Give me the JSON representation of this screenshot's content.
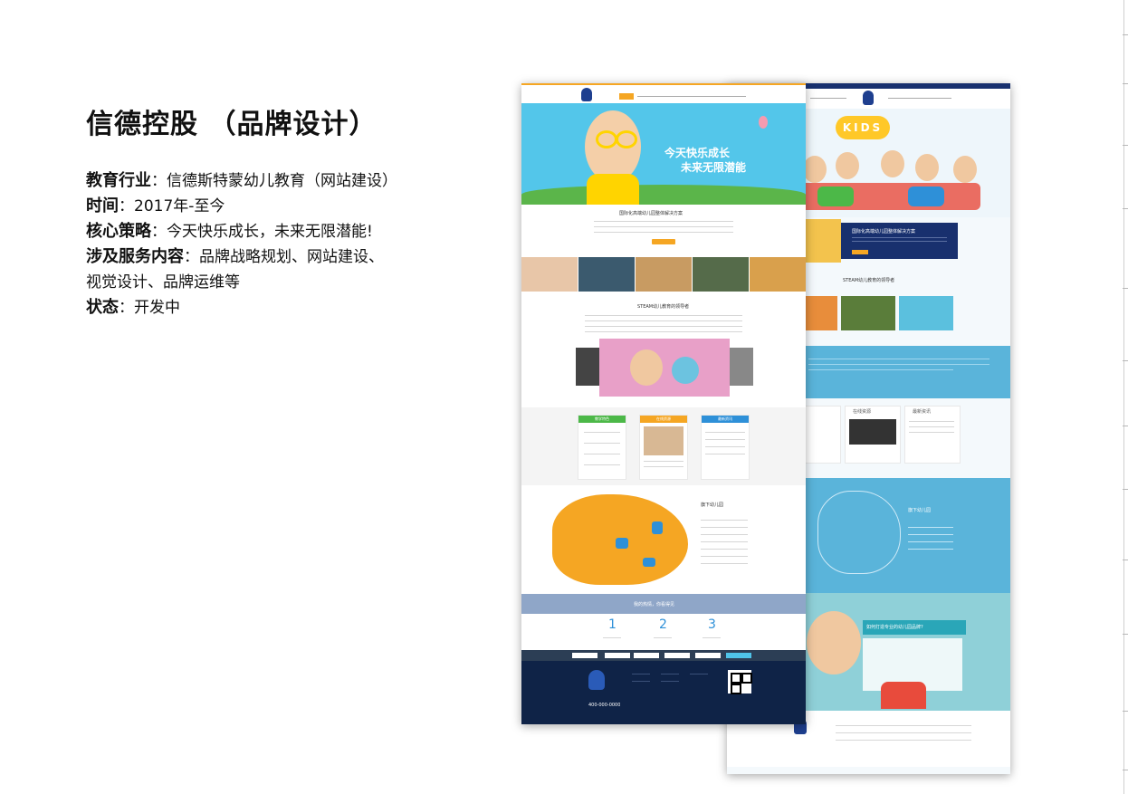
{
  "title": "信德控股 （品牌设计）",
  "details": [
    {
      "label": "教育行业",
      "sep": "：",
      "value": "信德斯特蒙幼儿教育（网站建设）"
    },
    {
      "label": "时间",
      "sep": "：",
      "value": "2017年-至今"
    },
    {
      "label": "核心策略",
      "sep": "：",
      "value": "今天快乐成长，未来无限潜能!"
    },
    {
      "label": "涉及服务内容",
      "sep": "：",
      "value": "品牌战略规划、网站建设、"
    },
    {
      "label": "",
      "sep": "",
      "value": "视觉设计、品牌运维等"
    },
    {
      "label": "状态",
      "sep": "：",
      "value": "开发中"
    }
  ],
  "mockA": {
    "hero_line1": "今天快乐成长",
    "hero_line2": "未来无限潜能",
    "solution_title": "国际化高端幼儿园整体解决方案",
    "steam_title": "STEAM幼儿教育的领导者",
    "tab1": "教学特色",
    "tab2": "在线资源",
    "tab3": "最新资讯",
    "map_title": "旗下幼儿园",
    "join_text": "我的热情，你看得见",
    "steps": [
      "1",
      "2",
      "3"
    ],
    "footer_phone": "400-000-0000",
    "colors": {
      "accent": "#f5a623",
      "sky": "#4fc3e8",
      "navy": "#0f2347",
      "band": "#8fa6c8",
      "green": "#4cb848",
      "blue": "#2e90d8"
    }
  },
  "mockB": {
    "kids_label": "KIDS",
    "solution_title": "国际化高端幼儿园整体解决方案",
    "steam_title": "STEAM幼儿教育的领导者",
    "tab2": "在线资源",
    "tab3": "最新资讯",
    "map_title": "旗下幼儿园",
    "banner_title": "如何打造专业的幼儿园品牌?",
    "colors": {
      "ocean": "#5ab4da",
      "navy": "#18306e",
      "yellow": "#ffc828"
    }
  }
}
